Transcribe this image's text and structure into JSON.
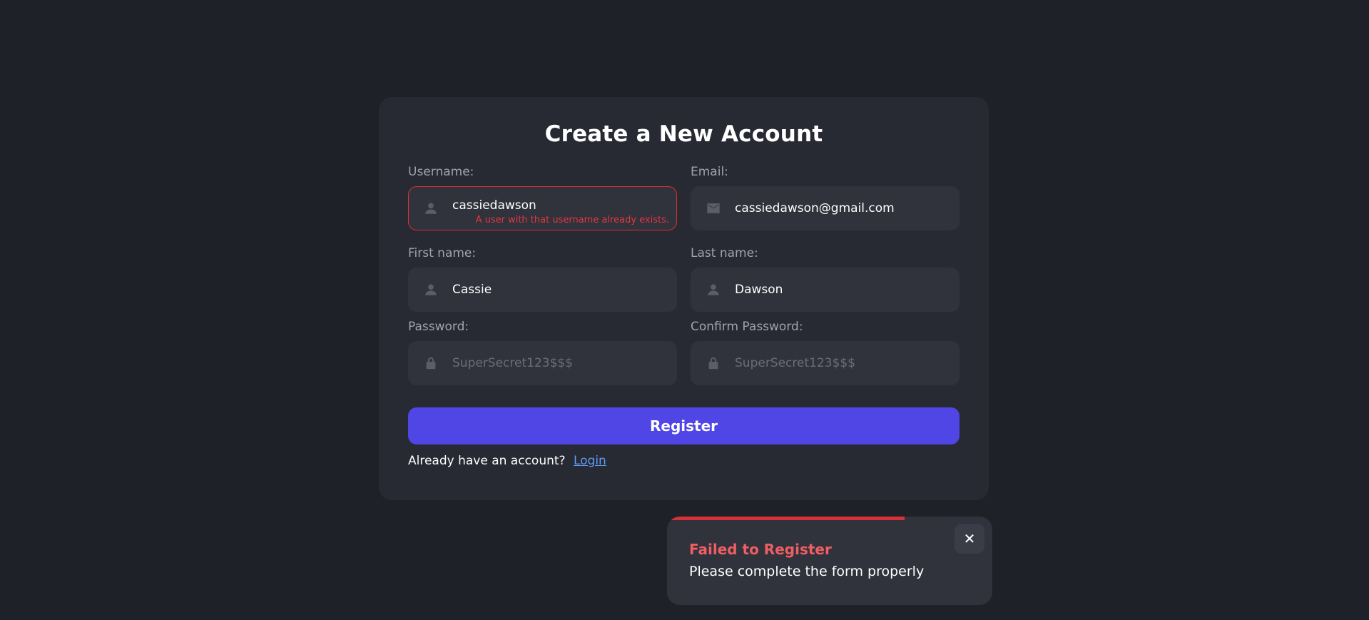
{
  "form": {
    "title": "Create a New Account",
    "username": {
      "label": "Username:",
      "value": "cassiedawson",
      "icon": "user-icon",
      "error": "A user with that username already exists."
    },
    "email": {
      "label": "Email:",
      "value": "cassiedawson@gmail.com",
      "icon": "mail-icon"
    },
    "first_name": {
      "label": "First name:",
      "value": "Cassie",
      "icon": "user-icon"
    },
    "last_name": {
      "label": "Last name:",
      "value": "Dawson",
      "icon": "user-icon"
    },
    "password": {
      "label": "Password:",
      "placeholder": "SuperSecret123$$$",
      "icon": "lock-icon"
    },
    "confirm_password": {
      "label": "Confirm Password:",
      "placeholder": "SuperSecret123$$$",
      "icon": "lock-icon"
    },
    "register_label": "Register",
    "login_prompt": "Already have an account?",
    "login_link": "Login"
  },
  "toast": {
    "title": "Failed to Register",
    "message": "Please complete the form properly",
    "close_label": "✕",
    "progress": 0.73
  },
  "colors": {
    "background": "#1f2129",
    "card": "#272933",
    "accent": "#4f46e5",
    "error": "#d92f37",
    "link": "#5e9cf5"
  }
}
